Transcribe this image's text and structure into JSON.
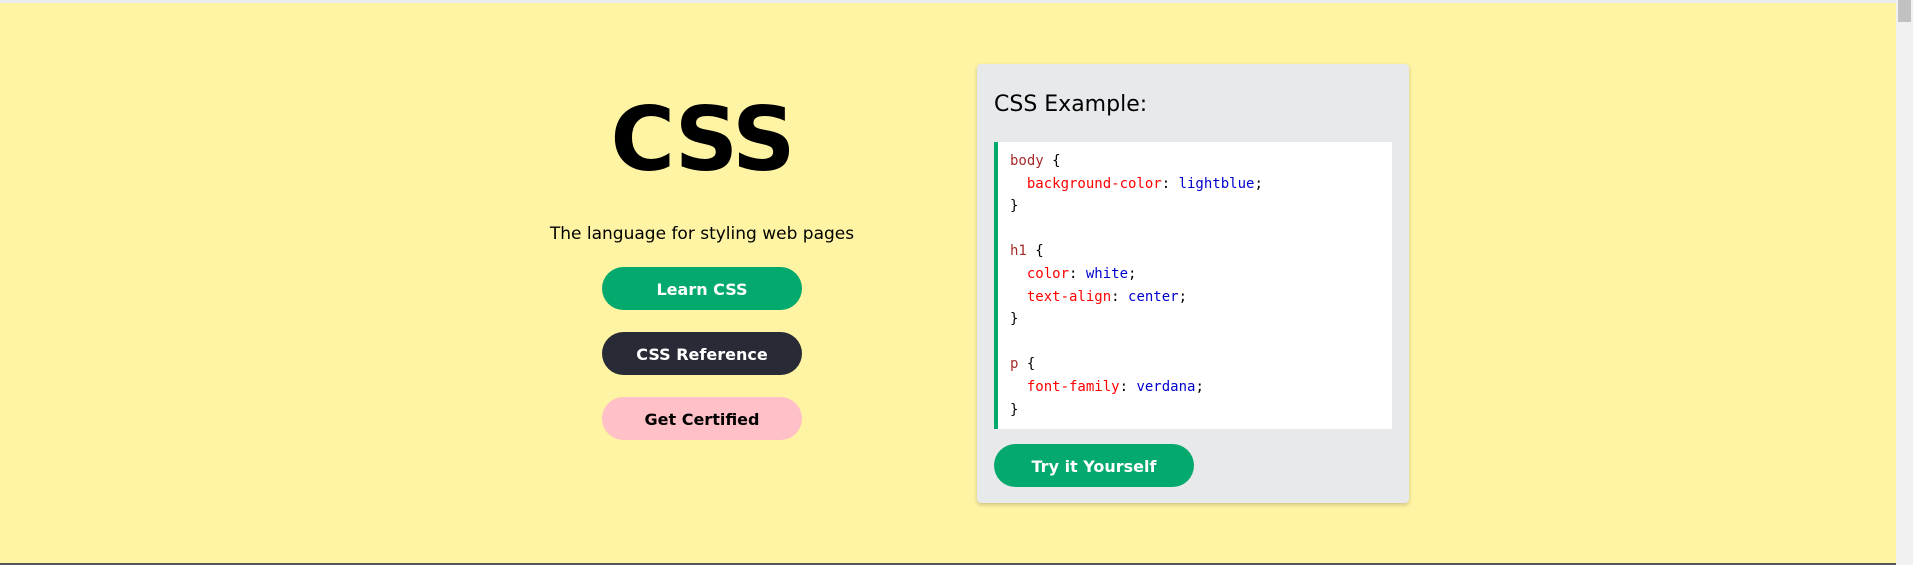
{
  "hero": {
    "title": "CSS",
    "subtitle": "The language for styling web pages",
    "buttons": {
      "learn": "Learn CSS",
      "reference": "CSS Reference",
      "certified": "Get Certified"
    }
  },
  "example": {
    "title": "CSS Example:",
    "code": [
      [
        {
          "t": "body",
          "c": "sel"
        },
        {
          "t": " {",
          "c": "punc"
        }
      ],
      [
        {
          "t": "  ",
          "c": "punc"
        },
        {
          "t": "background-color",
          "c": "prop"
        },
        {
          "t": ": ",
          "c": "punc"
        },
        {
          "t": "lightblue",
          "c": "val"
        },
        {
          "t": ";",
          "c": "punc"
        }
      ],
      [
        {
          "t": "}",
          "c": "punc"
        }
      ],
      [
        {
          "t": "",
          "c": "punc"
        }
      ],
      [
        {
          "t": "h1",
          "c": "sel"
        },
        {
          "t": " {",
          "c": "punc"
        }
      ],
      [
        {
          "t": "  ",
          "c": "punc"
        },
        {
          "t": "color",
          "c": "prop"
        },
        {
          "t": ": ",
          "c": "punc"
        },
        {
          "t": "white",
          "c": "val"
        },
        {
          "t": ";",
          "c": "punc"
        }
      ],
      [
        {
          "t": "  ",
          "c": "punc"
        },
        {
          "t": "text-align",
          "c": "prop"
        },
        {
          "t": ": ",
          "c": "punc"
        },
        {
          "t": "center",
          "c": "val"
        },
        {
          "t": ";",
          "c": "punc"
        }
      ],
      [
        {
          "t": "}",
          "c": "punc"
        }
      ],
      [
        {
          "t": "",
          "c": "punc"
        }
      ],
      [
        {
          "t": "p",
          "c": "sel"
        },
        {
          "t": " {",
          "c": "punc"
        }
      ],
      [
        {
          "t": "  ",
          "c": "punc"
        },
        {
          "t": "font-family",
          "c": "prop"
        },
        {
          "t": ": ",
          "c": "punc"
        },
        {
          "t": "verdana",
          "c": "val"
        },
        {
          "t": ";",
          "c": "punc"
        }
      ],
      [
        {
          "t": "}",
          "c": "punc"
        }
      ]
    ],
    "try_button": "Try it Yourself"
  },
  "colors": {
    "background": "#fff4a3",
    "green": "#04aa6d",
    "dark": "#282a35",
    "pink": "#ffc0c7",
    "card": "#e7e9eb"
  }
}
